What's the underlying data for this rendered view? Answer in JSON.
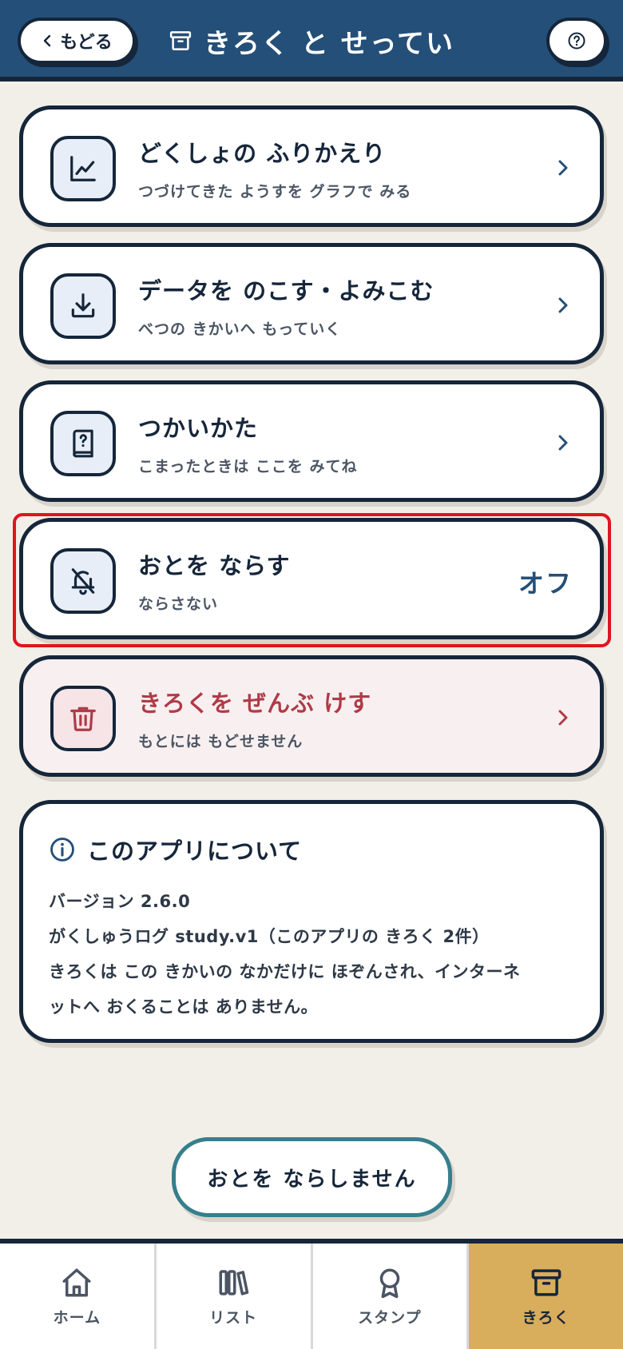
{
  "header": {
    "back_label": "もどる",
    "title": "きろく と せってい",
    "title_icon": "archive-box-icon",
    "help_icon": "question-circle-icon"
  },
  "menu": [
    {
      "id": "review",
      "title": "どくしょの ふりかえり",
      "subtitle": "つづけてきた ようすを グラフで みる",
      "icon": "chart-line-icon",
      "accessory": "chevron"
    },
    {
      "id": "data",
      "title": "データを のこす・よみこむ",
      "subtitle": "べつの きかいへ もっていく",
      "icon": "download-icon",
      "accessory": "chevron"
    },
    {
      "id": "howto",
      "title": "つかいかた",
      "subtitle": "こまったときは ここを みてね",
      "icon": "book-question-icon",
      "accessory": "chevron"
    },
    {
      "id": "sound",
      "title": "おとを ならす",
      "subtitle": "ならさない",
      "icon": "bell-off-icon",
      "value": "オフ"
    },
    {
      "id": "delete",
      "title": "きろくを ぜんぶ けす",
      "subtitle": "もとには もどせません",
      "icon": "trash-icon",
      "accessory": "chevron"
    }
  ],
  "about": {
    "title": "このアプリについて",
    "lines": [
      "バージョン 2.6.0",
      "がくしゅうログ study.v1（このアプリの きろく 2件）",
      "きろくは この きかいの なかだけに ほぞんされ、インターネ",
      "ットへ おくることは ありません。"
    ]
  },
  "mute_button": "おとを ならしません",
  "tabs": [
    {
      "label": "ホーム",
      "icon": "home-icon"
    },
    {
      "label": "リスト",
      "icon": "books-icon"
    },
    {
      "label": "スタンプ",
      "icon": "award-icon"
    },
    {
      "label": "きろく",
      "icon": "archive-box-icon",
      "active": true
    }
  ],
  "colors": {
    "header_bg": "#244f78",
    "ink": "#15263a",
    "danger": "#b03a48",
    "active_tab": "#d8ad5c",
    "teal": "#357f8c"
  }
}
